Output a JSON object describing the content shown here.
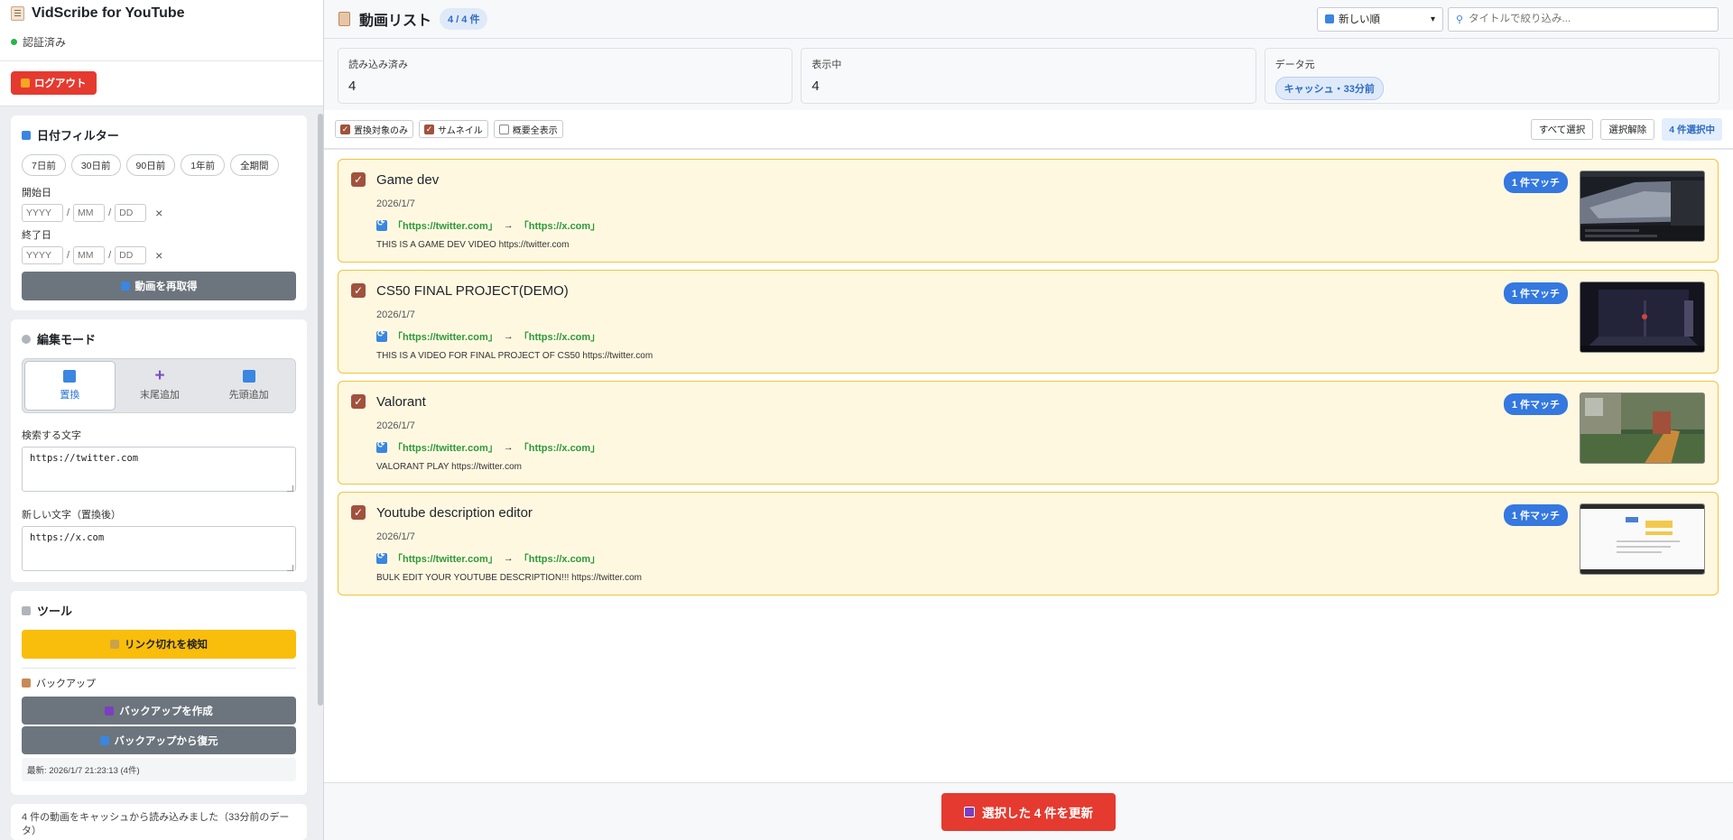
{
  "app": {
    "title": "VidScribe for YouTube",
    "auth_status": "認証済み",
    "logout_label": "ログアウト"
  },
  "date_filter": {
    "title": "日付フィルター",
    "presets": [
      "7日前",
      "30日前",
      "90日前",
      "1年前",
      "全期間"
    ],
    "start_label": "開始日",
    "end_label": "終了日",
    "year_placeholder": "YYYY",
    "month_placeholder": "MM",
    "day_placeholder": "DD",
    "clear": "×",
    "refetch_label": "動画を再取得"
  },
  "edit_mode": {
    "title": "編集モード",
    "modes": [
      {
        "label": "置換",
        "icon": "replace-icon",
        "active": true
      },
      {
        "label": "末尾追加",
        "icon": "plus-icon",
        "active": false
      },
      {
        "label": "先頭追加",
        "icon": "arrow-up-icon",
        "active": false
      }
    ],
    "search_label": "検索する文字",
    "search_value": "https://twitter.com",
    "replace_label": "新しい文字（置換後）",
    "replace_value": "https://x.com"
  },
  "tools": {
    "title": "ツール",
    "broken_link_label": "リンク切れを検知",
    "backup_title": "バックアップ",
    "backup_create_label": "バックアップを作成",
    "backup_restore_label": "バックアップから復元",
    "last_backup": "最新: 2026/1/7 21:23:13 (4件)"
  },
  "status_message": "4 件の動画をキャッシュから読み込みました（33分前のデータ）",
  "header": {
    "title": "動画リスト",
    "count": "4 / 4 件",
    "sort_value": "新しい順",
    "search_placeholder": "タイトルで絞り込み..."
  },
  "stats": {
    "loaded_label": "読み込み済み",
    "loaded_value": "4",
    "showing_label": "表示中",
    "showing_value": "4",
    "source_label": "データ元",
    "source_value": "キャッシュ・33分前"
  },
  "toolbar": {
    "only_targets": "置換対象のみ",
    "thumbnails": "サムネイル",
    "show_full_desc": "概要全表示",
    "select_all": "すべて選択",
    "deselect": "選択解除",
    "selected_count": "4 件選択中"
  },
  "videos": [
    {
      "title": "Game dev",
      "date": "2026/1/7",
      "from": "「https://twitter.com」",
      "arrow": "→",
      "to": "「https://x.com」",
      "desc": "THIS IS A GAME DEV VIDEO https://twitter.com",
      "match": "1 件マッチ"
    },
    {
      "title": "CS50 FINAL PROJECT(DEMO)",
      "date": "2026/1/7",
      "from": "「https://twitter.com」",
      "arrow": "→",
      "to": "「https://x.com」",
      "desc": "THIS IS A VIDEO FOR FINAL PROJECT OF CS50 https://twitter.com",
      "match": "1 件マッチ"
    },
    {
      "title": "Valorant",
      "date": "2026/1/7",
      "from": "「https://twitter.com」",
      "arrow": "→",
      "to": "「https://x.com」",
      "desc": "VALORANT PLAY https://twitter.com",
      "match": "1 件マッチ"
    },
    {
      "title": "Youtube description editor",
      "date": "2026/1/7",
      "from": "「https://twitter.com」",
      "arrow": "→",
      "to": "「https://x.com」",
      "desc": "BULK EDIT YOUR YOUTUBE DESCRIPTION!!! https://twitter.com",
      "match": "1 件マッチ"
    }
  ],
  "footer": {
    "update_label": "選択した 4 件を更新"
  },
  "colors": {
    "accent_red": "#e53a2f",
    "accent_blue": "#3478e0",
    "accent_yellow": "#f9bd0b",
    "card_bg": "#fff8e1",
    "card_border": "#f3c33a",
    "green_text": "#2d9a3a"
  }
}
